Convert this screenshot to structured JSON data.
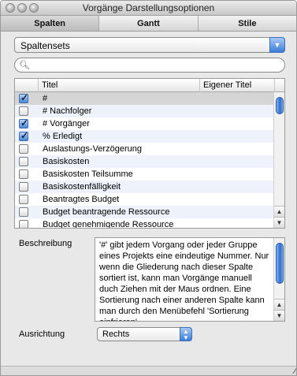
{
  "window": {
    "title": "Vorgänge Darstellungsoptionen"
  },
  "tabs": [
    {
      "label": "Spalten",
      "active": true
    },
    {
      "label": "Gantt",
      "active": false
    },
    {
      "label": "Stile",
      "active": false
    }
  ],
  "columnsets_popup": {
    "selected": "Spaltensets"
  },
  "search": {
    "value": "",
    "placeholder": ""
  },
  "table": {
    "headers": {
      "title": "Titel",
      "own_title": "Eigener Titel"
    },
    "rows": [
      {
        "checked": true,
        "title": "#"
      },
      {
        "checked": false,
        "title": "# Nachfolger"
      },
      {
        "checked": true,
        "title": "# Vorgänger"
      },
      {
        "checked": true,
        "title": "% Erledigt"
      },
      {
        "checked": false,
        "title": "Auslastungs-Verzögerung"
      },
      {
        "checked": false,
        "title": "Basiskosten"
      },
      {
        "checked": false,
        "title": "Basiskosten Teilsumme"
      },
      {
        "checked": false,
        "title": "Basiskostenfälligkeit"
      },
      {
        "checked": false,
        "title": "Beantragtes Budget"
      },
      {
        "checked": false,
        "title": "Budget beantragende Ressource"
      },
      {
        "checked": false,
        "title": "Budget genehmigende Ressource"
      }
    ]
  },
  "description": {
    "label": "Beschreibung",
    "text": "'#' gibt jedem Vorgang oder jeder Gruppe eines Projekts eine eindeutige Nummer. Nur wenn die Gliederung nach dieser Spalte sortiert ist, kann man Vorgänge manuell duch Ziehen mit der Maus ordnen. Eine Sortierung nach einer anderen Spalte kann man durch den Menübefehl 'Sortierung einfrieren'"
  },
  "alignment": {
    "label": "Ausrichtung",
    "selected": "Rechts"
  },
  "colors": {
    "accent": "#3a7ed9",
    "selected_row": "#d5d5d5",
    "alt_row": "#eef2fa"
  },
  "icons": {
    "popup_arrow": "chevron-down-icon",
    "search": "magnifier-icon",
    "stepper": "up-down-arrows-icon",
    "resize": "resize-grip-icon"
  }
}
